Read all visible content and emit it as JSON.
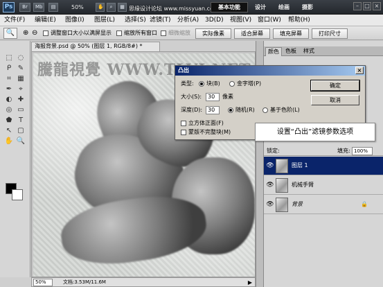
{
  "titlebar": {
    "logo": "Ps",
    "btn_br": "Br",
    "btn_mb": "Mb",
    "zoom": "50%",
    "watermark": "思缘设计论坛 www.missyuan.com",
    "workspace": "基本功能",
    "menus": [
      "设计",
      "绘画",
      "摄影"
    ],
    "window_buttons": [
      "–",
      "□",
      "×"
    ]
  },
  "menubar": {
    "items": [
      "文件(F)",
      "编辑(E)",
      "图像(I)",
      "图层(L)",
      "选择(S)",
      "滤镜(T)",
      "分析(A)",
      "3D(D)",
      "视图(V)",
      "窗口(W)",
      "帮助(H)"
    ]
  },
  "options": {
    "tool_glyph": "🔍",
    "zoom_in": "⊕",
    "zoom_out": "⊖",
    "chk1": "调整窗口大小以满屏显示",
    "chk2": "缩放所有窗口",
    "chk3": "细微缩放",
    "btn1": "实际像素",
    "btn2": "适合屏幕",
    "btn3": "填充屏幕",
    "btn4": "打印尺寸"
  },
  "toolbox": {
    "tools": [
      "⬚",
      "◌",
      "ᑭ",
      "✎",
      "⌗",
      "▦",
      "✒",
      "⌖",
      "◐",
      "✚",
      "◎",
      "▭",
      "⬟",
      "T",
      "↖",
      "▢",
      "✋",
      "🔍"
    ]
  },
  "document": {
    "tab": "海报背景.psd @ 50% (图层 1, RGB/8#) *",
    "watermark": "騰龍視覺 WWW.TLVI.NET",
    "zoom": "50%",
    "doc_info": "文档:3.53M/11.6M",
    "status_arrow": "▶"
  },
  "panels": {
    "tabs": [
      "颜色",
      "色板",
      "样式"
    ],
    "lock_label": "锁定:",
    "fill_label": "填充:",
    "fill_value": "100%",
    "layers": [
      {
        "name": "图层 1",
        "selected": true,
        "lock": ""
      },
      {
        "name": "机械手臂",
        "selected": false,
        "lock": ""
      },
      {
        "name": "背景",
        "selected": false,
        "lock": "🔒"
      }
    ],
    "eye": "👁"
  },
  "dialog": {
    "title": "凸出",
    "close": "×",
    "type_label": "类型:",
    "type_block": "块(B)",
    "type_pyramid": "金字塔(P)",
    "size_label": "大小(S):",
    "size_value": "30",
    "size_unit": "像素",
    "depth_label": "深度(D):",
    "depth_value": "30",
    "depth_random": "随机(R)",
    "depth_level": "基于色阶(L)",
    "chk_cube": "立方体正面(F)",
    "chk_mask": "蒙版不完整块(M)",
    "ok": "确定",
    "cancel": "取消"
  },
  "callout": "设置“凸出”滤镜参数选项"
}
